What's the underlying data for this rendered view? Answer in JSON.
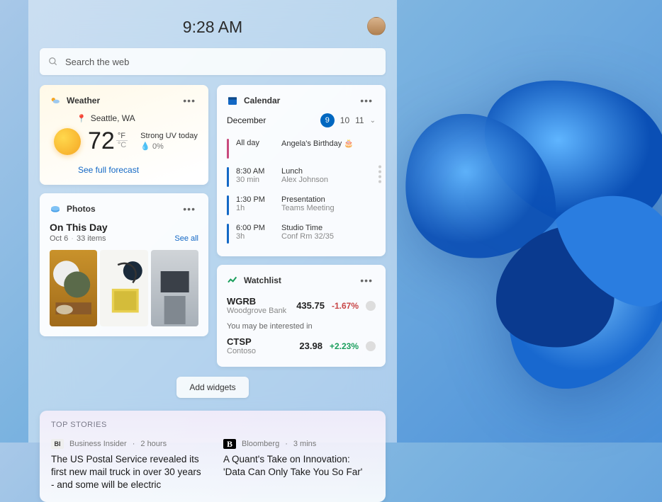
{
  "time": "9:28 AM",
  "search": {
    "placeholder": "Search the web"
  },
  "weather": {
    "title": "Weather",
    "location": "Seattle, WA",
    "temp": "72",
    "unit_f": "°F",
    "unit_c": "°C",
    "condition": "Strong UV today",
    "precip": "0%",
    "link": "See full forecast"
  },
  "photos": {
    "title": "Photos",
    "headline": "On This Day",
    "date": "Oct 6",
    "count": "33 items",
    "seeall": "See all"
  },
  "calendar": {
    "title": "Calendar",
    "month": "December",
    "dates": [
      "9",
      "10",
      "11"
    ],
    "events": [
      {
        "bar": "#c84a7d",
        "t1": "All day",
        "t2": "",
        "b1": "Angela's Birthday 🎂",
        "b2": ""
      },
      {
        "bar": "#1368c5",
        "t1": "8:30 AM",
        "t2": "30 min",
        "b1": "Lunch",
        "b2": "Alex Johnson"
      },
      {
        "bar": "#1368c5",
        "t1": "1:30 PM",
        "t2": "1h",
        "b1": "Presentation",
        "b2": "Teams Meeting"
      },
      {
        "bar": "#1368c5",
        "t1": "6:00 PM",
        "t2": "3h",
        "b1": "Studio Time",
        "b2": "Conf Rm 32/35"
      }
    ]
  },
  "watchlist": {
    "title": "Watchlist",
    "rows": [
      {
        "sym": "WGRB",
        "name": "Woodgrove Bank",
        "price": "435.75",
        "change": "-1.67%",
        "dir": "neg"
      }
    ],
    "interest": "You may be interested in",
    "rows2": [
      {
        "sym": "CTSP",
        "name": "Contoso",
        "price": "23.98",
        "change": "+2.23%",
        "dir": "pos"
      }
    ]
  },
  "add_widgets": "Add widgets",
  "news": {
    "label": "TOP STORIES",
    "stories": [
      {
        "src": "Business Insider",
        "age": "2 hours",
        "title": "The US Postal Service revealed its first new mail truck in over 30 years - and some will be electric"
      },
      {
        "src": "Bloomberg",
        "age": "3 mins",
        "title": "A Quant's Take on Innovation: 'Data Can Only Take You So Far'"
      }
    ]
  }
}
